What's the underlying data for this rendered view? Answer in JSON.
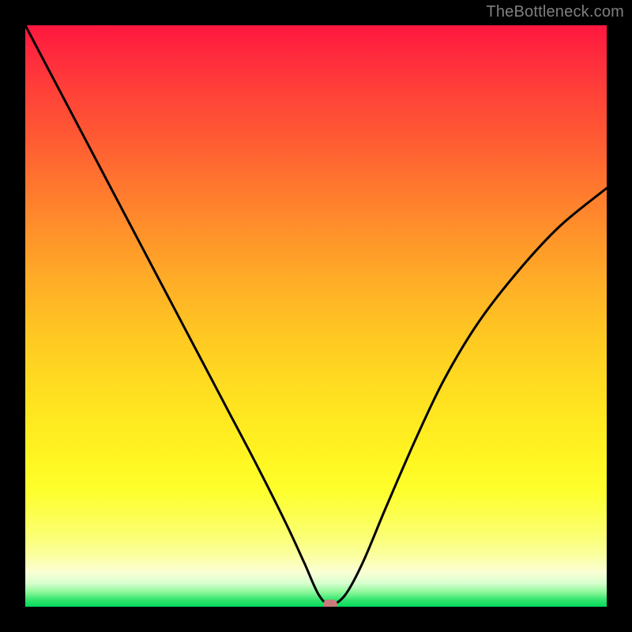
{
  "watermark": "TheBottleneck.com",
  "marker": {
    "x_frac": 0.525,
    "y_frac": 0.996
  },
  "chart_data": {
    "type": "line",
    "title": "",
    "xlabel": "",
    "ylabel": "",
    "xlim": [
      0,
      1
    ],
    "ylim": [
      0,
      1
    ],
    "series": [
      {
        "name": "bottleneck-curve",
        "x": [
          0.0,
          0.05,
          0.1,
          0.15,
          0.2,
          0.25,
          0.3,
          0.35,
          0.4,
          0.45,
          0.48,
          0.505,
          0.525,
          0.55,
          0.58,
          0.62,
          0.67,
          0.72,
          0.78,
          0.85,
          0.92,
          1.0
        ],
        "y": [
          1.0,
          0.905,
          0.81,
          0.715,
          0.62,
          0.525,
          0.43,
          0.335,
          0.24,
          0.14,
          0.075,
          0.02,
          0.004,
          0.02,
          0.075,
          0.17,
          0.285,
          0.39,
          0.49,
          0.58,
          0.655,
          0.72
        ]
      }
    ],
    "background_gradient": {
      "top": "#ff173f",
      "bottom": "#04d95b"
    },
    "marker_point": {
      "x": 0.525,
      "y": 0.004,
      "color": "#c97b7b"
    }
  }
}
